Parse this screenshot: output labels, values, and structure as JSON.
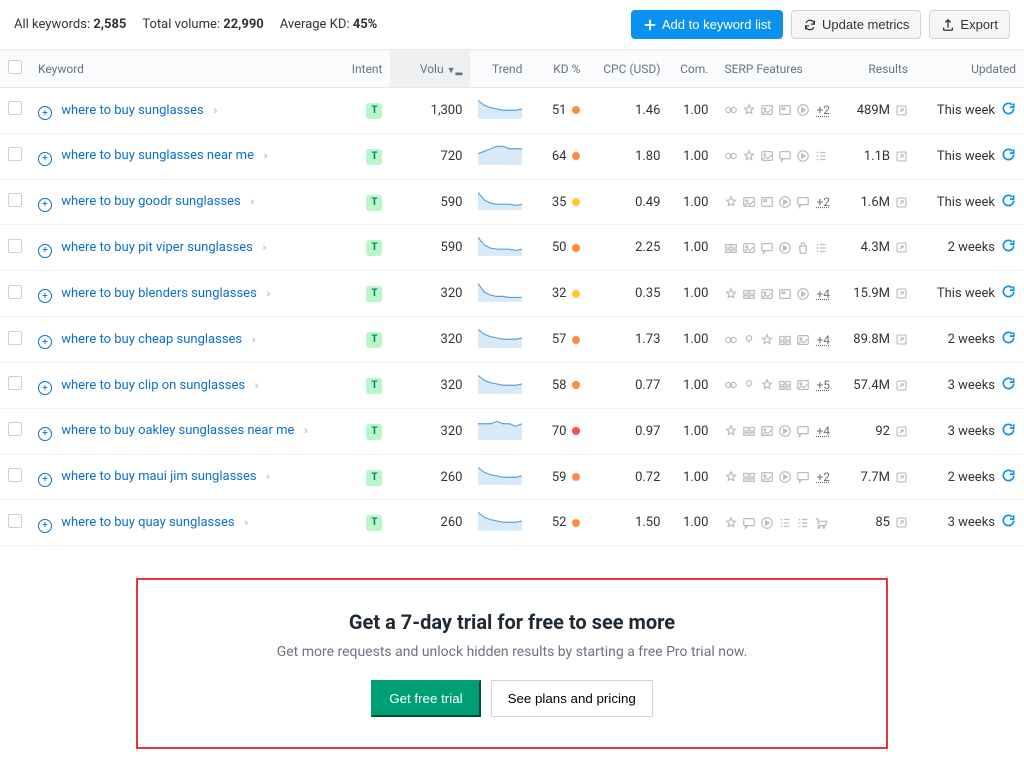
{
  "summary": {
    "all_keywords_label": "All keywords:",
    "all_keywords_value": "2,585",
    "total_volume_label": "Total volume:",
    "total_volume_value": "22,990",
    "avg_kd_label": "Average KD:",
    "avg_kd_value": "45%"
  },
  "toolbar": {
    "add_label": "Add to keyword list",
    "update_label": "Update metrics",
    "export_label": "Export"
  },
  "columns": {
    "keyword": "Keyword",
    "intent": "Intent",
    "volume": "Volu",
    "trend": "Trend",
    "kd": "KD %",
    "cpc": "CPC (USD)",
    "com": "Com.",
    "serp": "SERP Features",
    "results": "Results",
    "updated": "Updated"
  },
  "intents": {
    "t": "T"
  },
  "rows": [
    {
      "keyword": "where to buy sunglasses",
      "intent": "t",
      "vol": "1,300",
      "trend": [
        14,
        10,
        8,
        7,
        6,
        6,
        6,
        7
      ],
      "kd": 51,
      "kd_color": "#ff8a3d",
      "cpc": "1.46",
      "com": "1.00",
      "serp": [
        "link",
        "star",
        "image",
        "video",
        "play"
      ],
      "more": "+2",
      "results": "489M",
      "updated": "This week"
    },
    {
      "keyword": "where to buy sunglasses near me",
      "intent": "t",
      "vol": "720",
      "trend": [
        4,
        5,
        6,
        7,
        7,
        6,
        6,
        6
      ],
      "kd": 64,
      "kd_color": "#ff8a3d",
      "cpc": "1.80",
      "com": "1.00",
      "serp": [
        "link",
        "star",
        "image",
        "msg",
        "play",
        "list"
      ],
      "results": "1.1B",
      "updated": "This week"
    },
    {
      "keyword": "where to buy goodr sunglasses",
      "intent": "t",
      "vol": "590",
      "trend": [
        16,
        9,
        6,
        5,
        5,
        5,
        4,
        5
      ],
      "kd": 35,
      "kd_color": "#ffc53d",
      "cpc": "0.49",
      "com": "1.00",
      "serp": [
        "star",
        "image",
        "video",
        "play",
        "msg"
      ],
      "more": "+2",
      "results": "1.6M",
      "updated": "This week"
    },
    {
      "keyword": "where to buy pit viper sunglasses",
      "intent": "t",
      "vol": "590",
      "trend": [
        16,
        9,
        6,
        5,
        5,
        5,
        4,
        5
      ],
      "kd": 50,
      "kd_color": "#ff8a3d",
      "cpc": "2.25",
      "com": "1.00",
      "serp": [
        "box",
        "image",
        "msg",
        "play",
        "bag",
        "list"
      ],
      "results": "4.3M",
      "updated": "2 weeks"
    },
    {
      "keyword": "where to buy blenders sunglasses",
      "intent": "t",
      "vol": "320",
      "trend": [
        16,
        8,
        5,
        4,
        4,
        3,
        3,
        3
      ],
      "kd": 32,
      "kd_color": "#ffc53d",
      "cpc": "0.35",
      "com": "1.00",
      "serp": [
        "star",
        "box",
        "image",
        "video",
        "play"
      ],
      "more": "+4",
      "results": "15.9M",
      "updated": "This week"
    },
    {
      "keyword": "where to buy cheap sunglasses",
      "intent": "t",
      "vol": "320",
      "trend": [
        14,
        10,
        8,
        7,
        6,
        6,
        6,
        7
      ],
      "kd": 57,
      "kd_color": "#ff8a3d",
      "cpc": "1.73",
      "com": "1.00",
      "serp": [
        "link",
        "q",
        "star",
        "box",
        "image"
      ],
      "more": "+4",
      "results": "89.8M",
      "updated": "2 weeks"
    },
    {
      "keyword": "where to buy clip on sunglasses",
      "intent": "t",
      "vol": "320",
      "trend": [
        14,
        10,
        8,
        7,
        6,
        6,
        6,
        7
      ],
      "kd": 58,
      "kd_color": "#ff8a3d",
      "cpc": "0.77",
      "com": "1.00",
      "serp": [
        "link",
        "q",
        "star",
        "box",
        "image"
      ],
      "more": "+5",
      "results": "57.4M",
      "updated": "3 weeks"
    },
    {
      "keyword": "where to buy oakley sunglasses near me",
      "intent": "t",
      "vol": "320",
      "trend": [
        6,
        6,
        6,
        7,
        6,
        6,
        5,
        6
      ],
      "kd": 70,
      "kd_color": "#ff4d4f",
      "cpc": "0.97",
      "com": "1.00",
      "serp": [
        "star",
        "box",
        "image",
        "play",
        "msg"
      ],
      "more": "+4",
      "results": "92",
      "updated": "3 weeks"
    },
    {
      "keyword": "where to buy maui jim sunglasses",
      "intent": "t",
      "vol": "260",
      "trend": [
        14,
        10,
        8,
        7,
        6,
        6,
        6,
        7
      ],
      "kd": 59,
      "kd_color": "#ff8a3d",
      "cpc": "0.72",
      "com": "1.00",
      "serp": [
        "star",
        "box",
        "image",
        "play",
        "msg"
      ],
      "more": "+2",
      "results": "7.7M",
      "updated": "2 weeks"
    },
    {
      "keyword": "where to buy quay sunglasses",
      "intent": "t",
      "vol": "260",
      "trend": [
        14,
        10,
        8,
        7,
        6,
        6,
        6,
        7
      ],
      "kd": 52,
      "kd_color": "#ff8a3d",
      "cpc": "1.50",
      "com": "1.00",
      "serp": [
        "star",
        "msg",
        "play",
        "list",
        "list",
        "cart"
      ],
      "results": "85",
      "updated": "3 weeks"
    }
  ],
  "promo": {
    "title": "Get a 7-day trial for free to see more",
    "subtitle": "Get more requests and unlock hidden results by starting a free Pro trial now.",
    "cta_primary": "Get free trial",
    "cta_secondary": "See plans and pricing"
  }
}
